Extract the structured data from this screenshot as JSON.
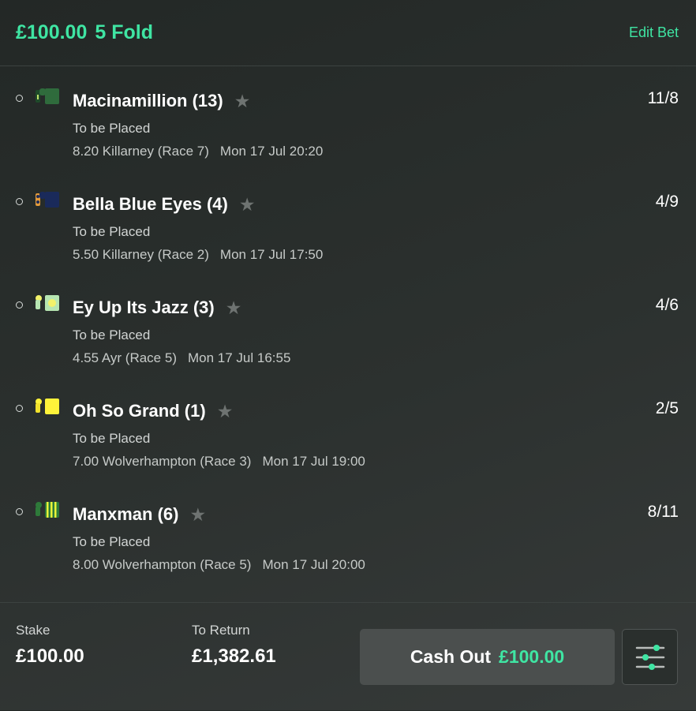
{
  "header": {
    "amount": "£100.00",
    "bet_type": "5 Fold",
    "edit_label": "Edit Bet"
  },
  "selections": [
    {
      "name": "Macinamillion (13)",
      "market": "To be Placed",
      "event": "8.20 Killarney (Race 7)",
      "time": "Mon 17 Jul 20:20",
      "odds": "11/8",
      "silk_colors": [
        "#2f6b3c",
        "#1f4a2a"
      ]
    },
    {
      "name": "Bella Blue Eyes (4)",
      "market": "To be Placed",
      "event": "5.50 Killarney (Race 2)",
      "time": "Mon 17 Jul 17:50",
      "odds": "4/9",
      "silk_colors": [
        "#1a2a5a",
        "#e29a3a"
      ]
    },
    {
      "name": "Ey Up Its Jazz (3)",
      "market": "To be Placed",
      "event": "4.55 Ayr (Race 5)",
      "time": "Mon 17 Jul 16:55",
      "odds": "4/6",
      "silk_colors": [
        "#f3f26a",
        "#b7e6b2"
      ]
    },
    {
      "name": "Oh So Grand (1)",
      "market": "To be Placed",
      "event": "7.00 Wolverhampton (Race 3)",
      "time": "Mon 17 Jul 19:00",
      "odds": "2/5",
      "silk_colors": [
        "#fff33a",
        "#f2e22c"
      ]
    },
    {
      "name": "Manxman (6)",
      "market": "To be Placed",
      "event": "8.00 Wolverhampton (Race 5)",
      "time": "Mon 17 Jul 20:00",
      "odds": "8/11",
      "silk_colors": [
        "#2e7a3a",
        "#e8f23a"
      ]
    }
  ],
  "footer": {
    "stake_label": "Stake",
    "stake_value": "£100.00",
    "return_label": "To Return",
    "return_value": "£1,382.61",
    "cashout_label": "Cash Out",
    "cashout_amount": "£100.00"
  },
  "colors": {
    "accent": "#3fe5a3",
    "background": "#2b302e",
    "button": "#4b4f4e"
  },
  "icons": {
    "star": "star-icon",
    "settings": "sliders-icon",
    "radio": "radio-icon"
  }
}
